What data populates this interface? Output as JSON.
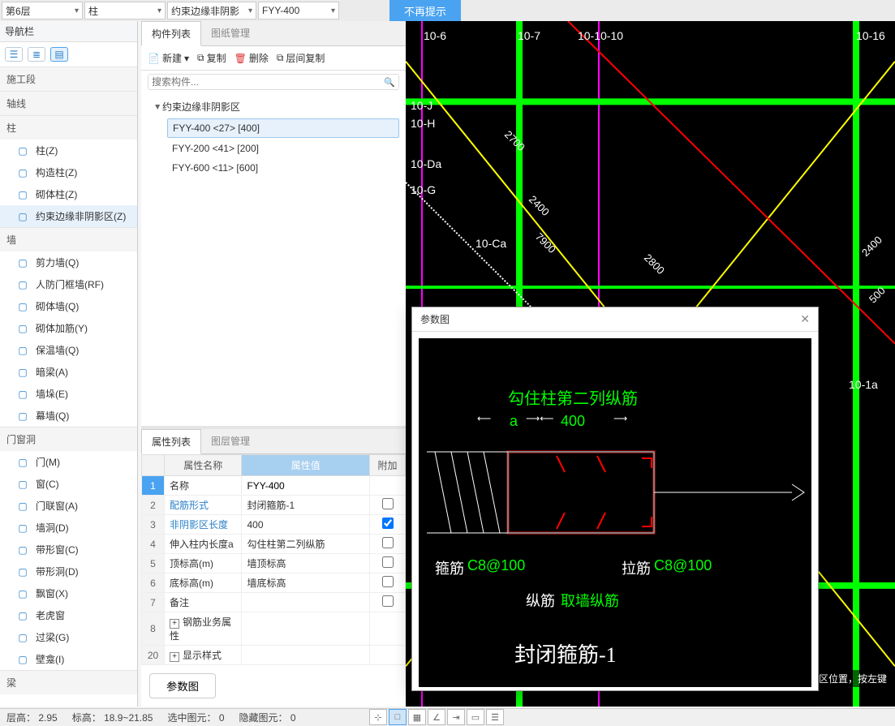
{
  "topbar": {
    "floor": "第6层",
    "category": "柱",
    "subcategory": "约束边缘非阴影",
    "code": "FYY-400",
    "dismiss": "不再提示"
  },
  "nav": {
    "title": "导航栏",
    "sections": [
      {
        "title": "施工段"
      },
      {
        "title": "轴线"
      },
      {
        "title": "柱",
        "items": [
          {
            "label": "柱(Z)",
            "icon": "column"
          },
          {
            "label": "构造柱(Z)",
            "icon": "constr-column"
          },
          {
            "label": "砌体柱(Z)",
            "icon": "masonry-column"
          },
          {
            "label": "约束边缘非阴影区(Z)",
            "icon": "boundary",
            "selected": true
          }
        ]
      },
      {
        "title": "墙",
        "items": [
          {
            "label": "剪力墙(Q)",
            "icon": "shearwall"
          },
          {
            "label": "人防门框墙(RF)",
            "icon": "rfwall"
          },
          {
            "label": "砌体墙(Q)",
            "icon": "masonrywall"
          },
          {
            "label": "砌体加筋(Y)",
            "icon": "reinf"
          },
          {
            "label": "保温墙(Q)",
            "icon": "insul"
          },
          {
            "label": "暗梁(A)",
            "icon": "hiddenbeam"
          },
          {
            "label": "墙垛(E)",
            "icon": "pier"
          },
          {
            "label": "幕墙(Q)",
            "icon": "curtain"
          }
        ]
      },
      {
        "title": "门窗洞",
        "items": [
          {
            "label": "门(M)"
          },
          {
            "label": "窗(C)"
          },
          {
            "label": "门联窗(A)"
          },
          {
            "label": "墙洞(D)"
          },
          {
            "label": "带形窗(C)"
          },
          {
            "label": "带形洞(D)"
          },
          {
            "label": "飘窗(X)"
          },
          {
            "label": "老虎窗"
          },
          {
            "label": "过梁(G)"
          },
          {
            "label": "壁龛(I)"
          }
        ]
      },
      {
        "title": "梁"
      }
    ]
  },
  "mid": {
    "tabs": {
      "components": "构件列表",
      "drawings": "图纸管理"
    },
    "toolbar": {
      "new": "新建",
      "copy": "复制",
      "delete": "删除",
      "floorcopy": "层间复制"
    },
    "search_placeholder": "搜索构件...",
    "tree": {
      "group": "约束边缘非阴影区",
      "items": [
        {
          "label": "FYY-400  <27>  [400]",
          "selected": true
        },
        {
          "label": "FYY-200  <41>  [200]"
        },
        {
          "label": "FYY-600  <11>  [600]"
        }
      ]
    }
  },
  "props": {
    "tabs": {
      "attrs": "属性列表",
      "layers": "图层管理"
    },
    "headers": {
      "name": "属性名称",
      "value": "属性值",
      "extra": "附加"
    },
    "rows": [
      {
        "n": "1",
        "name": "名称",
        "value": "FYY-400",
        "editable": true,
        "selected": true
      },
      {
        "n": "2",
        "name": "配筋形式",
        "value": "封闭箍筋-1",
        "link": true,
        "chk": false
      },
      {
        "n": "3",
        "name": "非阴影区长度",
        "value": "400",
        "link": true,
        "chk": true
      },
      {
        "n": "4",
        "name": "伸入柱内长度a",
        "value": "勾住柱第二列纵筋",
        "chk": false
      },
      {
        "n": "5",
        "name": "顶标高(m)",
        "value": "墙顶标高",
        "chk": false
      },
      {
        "n": "6",
        "name": "底标高(m)",
        "value": "墙底标高",
        "chk": false
      },
      {
        "n": "7",
        "name": "备注",
        "value": "",
        "chk": false
      },
      {
        "n": "8",
        "name": "钢筋业务属性",
        "value": "",
        "expand": "+"
      },
      {
        "n": "20",
        "name": "显示样式",
        "value": "",
        "expand": "+"
      }
    ],
    "param_btn": "参数图"
  },
  "dialog": {
    "title": "参数图",
    "top_label": "勾住柱第二列纵筋",
    "a": "a",
    "len": "400",
    "hoop_lbl": "箍筋",
    "hoop_val": "C8@100",
    "tie_lbl": "拉筋",
    "tie_val": "C8@100",
    "long_lbl": "纵筋",
    "long_val": "取墙纵筋",
    "name": "封闭箍筋-1"
  },
  "canvas": {
    "grid_labels": [
      "10-6",
      "10-7",
      "10-10-10",
      "10-16",
      "10-J",
      "10-H",
      "10-Da",
      "10-G",
      "10-Ca",
      "10-1a"
    ],
    "dims": [
      "2700",
      "2400",
      "2400",
      "7900",
      "2800",
      "500"
    ]
  },
  "status": {
    "h": "层高：",
    "hv": "2.95",
    "t": "标高：",
    "tv": "18.9~21.85",
    "sel": "选中图元：",
    "selv": "0",
    "hid": "隐藏图元：",
    "hidv": "0",
    "hint": "影区位置，按左键"
  }
}
